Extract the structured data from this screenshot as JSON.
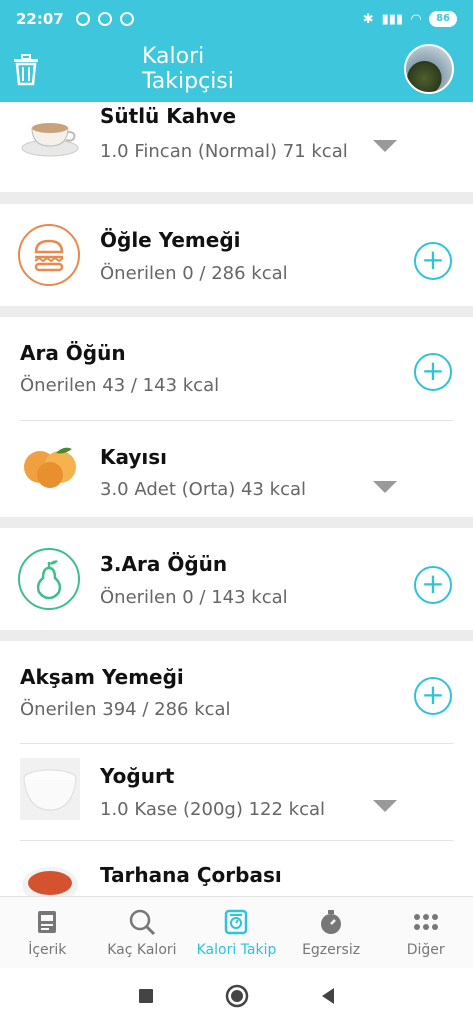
{
  "status_bar": {
    "time": "22:07",
    "battery": "86"
  },
  "app": {
    "title": "Kalori Takipçisi"
  },
  "entries": {
    "sutlu_kahve": {
      "name": "Sütlü Kahve",
      "detail": "1.0 Fincan (Normal) 71 kcal"
    },
    "ogle": {
      "name": "Öğle Yemeği",
      "detail": "Önerilen 0 / 286 kcal"
    },
    "ara_ogun": {
      "name": "Ara Öğün",
      "detail": "Önerilen 43 / 143 kcal"
    },
    "kayisi": {
      "name": "Kayısı",
      "detail": "3.0 Adet (Orta) 43 kcal"
    },
    "ara_ogun_3": {
      "name": "3.Ara Öğün",
      "detail": "Önerilen 0 / 143 kcal"
    },
    "aksam": {
      "name": "Akşam Yemeği",
      "detail": "Önerilen 394 / 286 kcal"
    },
    "yogurt": {
      "name": "Yoğurt",
      "detail": "1.0 Kase (200g) 122 kcal"
    },
    "tarhana": {
      "name": "Tarhana Çorbası"
    }
  },
  "bottom_nav": [
    {
      "label": "İçerik",
      "icon": "document-icon"
    },
    {
      "label": "Kaç Kalori",
      "icon": "search-icon"
    },
    {
      "label": "Kalori Takip",
      "icon": "scale-icon",
      "active": true
    },
    {
      "label": "Egzersiz",
      "icon": "stopwatch-icon"
    },
    {
      "label": "Diğer",
      "icon": "grid-dots-icon"
    }
  ],
  "colors": {
    "accent": "#3ec6dd",
    "plus": "#2ec3da",
    "orange": "#e8894e",
    "green": "#3cbf8a"
  }
}
